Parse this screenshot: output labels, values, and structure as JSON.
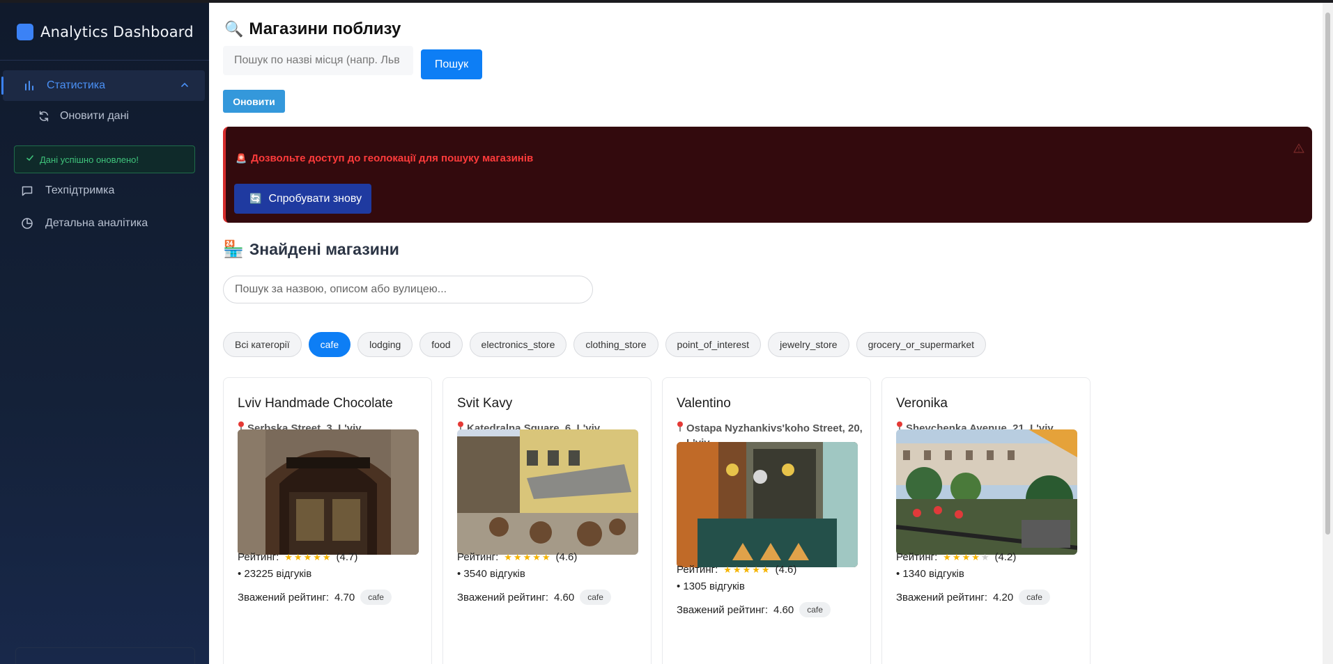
{
  "sidebar": {
    "brand_title": "Analytics Dashboard",
    "nav_statistics": "Статистика",
    "nav_refresh_data": "Оновити дані",
    "toast_success": "Дані успішно оновлено!",
    "nav_support": "Техпідтримка",
    "nav_detailed": "Детальна аналітика",
    "accent_color": "#3b82f6"
  },
  "header": {
    "icon": "🔍",
    "title": "Магазини поблизу",
    "place_search_placeholder": "Пошук по назві місця (напр. Льв",
    "search_button": "Пошук",
    "refresh_button": "Оновити"
  },
  "alert": {
    "icon": "🚨",
    "message": "Дозвольте доступ до геолокації для пошуку магазинів",
    "warn_icon": "⚠",
    "retry_icon": "🔄",
    "retry_button": "Спробувати знову"
  },
  "found": {
    "icon": "🏪",
    "title": "Знайдені магазини",
    "search_placeholder": "Пошук за назвою, описом або вулицею...",
    "categories": [
      "Всі категорії",
      "cafe",
      "lodging",
      "food",
      "electronics_store",
      "clothing_store",
      "point_of_interest",
      "jewelry_store",
      "grocery_or_supermarket"
    ],
    "active_category": "cafe"
  },
  "labels": {
    "rating": "Рейтинг:",
    "weighted": "Зважений рейтинг:"
  },
  "shops": [
    {
      "name": "Lviv Handmade Chocolate",
      "address": "Serbska Street, 3, L'viv",
      "stars": 5,
      "rating": "(4.7)",
      "reviews": "• 23225 відгуків",
      "weighted": "4.70",
      "tag": "cafe"
    },
    {
      "name": "Svit Kavy",
      "address": "Katedralna Square, 6, L'viv",
      "stars": 5,
      "rating": "(4.6)",
      "reviews": "• 3540 відгуків",
      "weighted": "4.60",
      "tag": "cafe"
    },
    {
      "name": "Valentino",
      "address": "Ostapa Nyzhankivs'koho Street, 20, L'viv",
      "stars": 5,
      "rating": "(4.6)",
      "reviews": "• 1305 відгуків",
      "weighted": "4.60",
      "tag": "cafe"
    },
    {
      "name": "Veronika",
      "address": "Shevchenka Avenue, 21, L'viv",
      "stars": 4,
      "rating": "(4.2)",
      "reviews": "• 1340 відгуків",
      "weighted": "4.20",
      "tag": "cafe"
    }
  ]
}
